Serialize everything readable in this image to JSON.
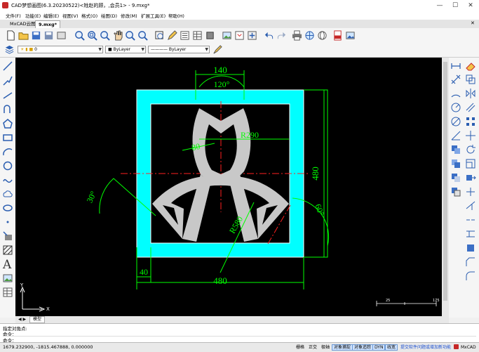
{
  "window": {
    "title": "CAD梦想画图(6.3.20230522)<姓赵的顾，,会员1> - 9.mxg*",
    "minimize": "—",
    "maximize": "☐",
    "close": "✕"
  },
  "menu": [
    "文件(F)",
    "功能(E)",
    "编辑(E)",
    "视图(V)",
    "格式(O)",
    "绘图(D)",
    "修改(M)",
    "扩展工具(E)",
    "帮助(H)"
  ],
  "tabs": {
    "cloud": "MxCAD云图",
    "file": "9.mxg*",
    "close": "✕"
  },
  "layer_toolbar": {
    "layer": "0",
    "color": "ByLayer",
    "linetype": "ByLayer"
  },
  "drawing": {
    "dims": {
      "top": "140",
      "angle_top": "120°",
      "radius_upper": "R290",
      "small": "80",
      "height": "480",
      "angle_left": "30°",
      "angle_right": "60°",
      "radius_lower": "R580",
      "small_bottom": "40",
      "width": "480"
    },
    "ucs": {
      "x": "X",
      "y": "Y"
    },
    "scale_bar": {
      "left": "25",
      "right": "175"
    },
    "colors": {
      "background": "#000000",
      "frame": "#00ffff",
      "shape": "#c8c8c8",
      "dimension": "#00ff00",
      "center": "#ff2020",
      "frame_line": "#ffffff"
    }
  },
  "model_tab": "模型",
  "command": {
    "line1": "指定对角点:",
    "line2": "命令：",
    "line3": "命令："
  },
  "status": {
    "coords": "1679.232900,  -1815.467888,  0.000000",
    "buttons": [
      "栅格",
      "正交",
      "极轴",
      "对象捕捉",
      "对象追踪",
      "DYN",
      "线宽"
    ],
    "notice": "提交软件问题或增加新功能",
    "brand": "MxCAD"
  }
}
